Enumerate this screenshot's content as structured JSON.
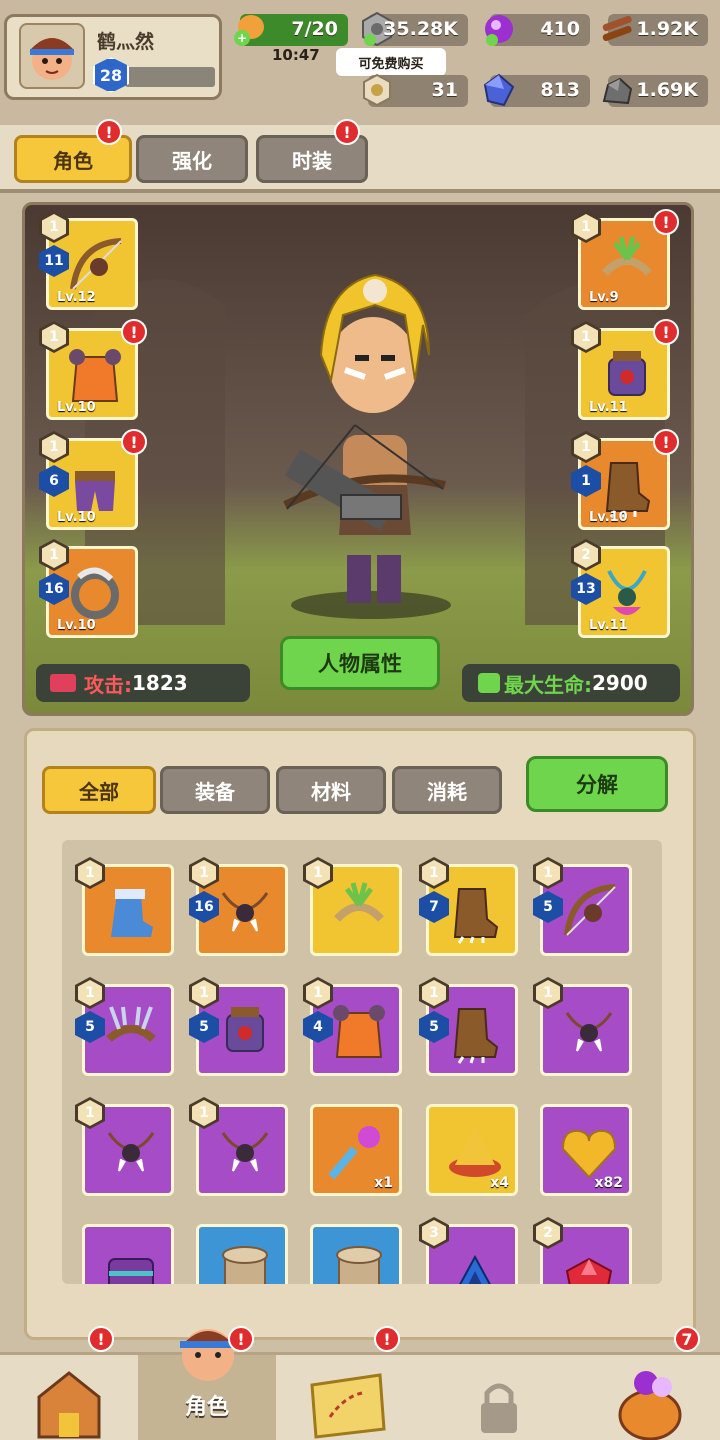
{
  "player": {
    "name": "鹤灬然",
    "level": "28"
  },
  "resources": {
    "stamina": "7/20",
    "stamina_timer": "10:47",
    "silver": "35.28K",
    "gems": "410",
    "wood": "1.92K",
    "medal": "31",
    "crystal": "813",
    "stone": "1.69K",
    "free_buy_tip": "可免费购买"
  },
  "tabs": [
    {
      "label": "角色",
      "active": true,
      "alert": "!"
    },
    {
      "label": "强化",
      "active": false,
      "alert": ""
    },
    {
      "label": "时装",
      "active": false,
      "alert": "!"
    }
  ],
  "equipment": {
    "left": [
      {
        "level": "Lv.12",
        "star": "1",
        "plus": "11",
        "color": "gold",
        "icon": "bow-icon",
        "alert": ""
      },
      {
        "level": "Lv.10",
        "star": "1",
        "plus": "",
        "color": "gold",
        "icon": "tunic-icon",
        "alert": "!"
      },
      {
        "level": "Lv.10",
        "star": "1",
        "plus": "6",
        "color": "gold",
        "icon": "pants-icon",
        "alert": "!"
      },
      {
        "level": "Lv.10",
        "star": "1",
        "plus": "16",
        "color": "orange",
        "icon": "tusk-ring-icon",
        "alert": ""
      }
    ],
    "right": [
      {
        "level": "Lv.9",
        "star": "1",
        "plus": "",
        "color": "orange",
        "icon": "leaf-headband-icon",
        "alert": "!"
      },
      {
        "level": "Lv.11",
        "star": "1",
        "plus": "",
        "color": "gold",
        "icon": "bracer-icon",
        "alert": "!"
      },
      {
        "level": "Lv.10",
        "star": "1",
        "plus": "1",
        "color": "orange",
        "icon": "claw-boots-icon",
        "alert": "!"
      },
      {
        "level": "Lv.11",
        "star": "2",
        "plus": "13",
        "color": "gold",
        "icon": "necklace-icon",
        "alert": ""
      }
    ]
  },
  "stats": {
    "attack_label": "攻击:",
    "attack_value": "1823",
    "hp_label": "最大生命:",
    "hp_value": "2900",
    "attributes_button": "人物属性"
  },
  "inventory": {
    "tabs": [
      "全部",
      "装备",
      "材料",
      "消耗"
    ],
    "decompose_button": "分解",
    "items": [
      {
        "color": "orange",
        "star": "1",
        "plus": "",
        "icon": "fur-boots-icon",
        "qty": ""
      },
      {
        "color": "orange",
        "star": "1",
        "plus": "16",
        "icon": "tooth-necklace-icon",
        "qty": ""
      },
      {
        "color": "gold",
        "star": "1",
        "plus": "",
        "icon": "leaf-headband-icon",
        "qty": ""
      },
      {
        "color": "gold",
        "star": "1",
        "plus": "7",
        "icon": "claw-boots-icon",
        "qty": ""
      },
      {
        "color": "purple",
        "star": "1",
        "plus": "5",
        "icon": "bow-icon",
        "qty": ""
      },
      {
        "color": "purple",
        "star": "1",
        "plus": "5",
        "icon": "antler-headband-icon",
        "qty": ""
      },
      {
        "color": "purple",
        "star": "1",
        "plus": "5",
        "icon": "bracer-icon",
        "qty": ""
      },
      {
        "color": "purple",
        "star": "1",
        "plus": "4",
        "icon": "tunic-icon",
        "qty": ""
      },
      {
        "color": "purple",
        "star": "1",
        "plus": "5",
        "icon": "claw-boots-icon",
        "qty": ""
      },
      {
        "color": "purple",
        "star": "1",
        "plus": "",
        "icon": "tooth-necklace-icon",
        "qty": ""
      },
      {
        "color": "purple",
        "star": "1",
        "plus": "",
        "icon": "tooth-necklace-icon",
        "qty": ""
      },
      {
        "color": "purple",
        "star": "1",
        "plus": "",
        "icon": "tooth-necklace-icon",
        "qty": ""
      },
      {
        "color": "orange",
        "star": "",
        "plus": "",
        "icon": "key-icon",
        "qty": "x1"
      },
      {
        "color": "gold",
        "star": "",
        "plus": "",
        "icon": "gold-pyramid-icon",
        "qty": "x4"
      },
      {
        "color": "purple",
        "star": "",
        "plus": "",
        "icon": "gold-heart-icon",
        "qty": "x82"
      },
      {
        "color": "purple",
        "star": "",
        "plus": "",
        "icon": "armor-plate-icon",
        "qty": ""
      },
      {
        "color": "blue",
        "star": "",
        "plus": "",
        "icon": "scroll-icon",
        "qty": ""
      },
      {
        "color": "blue",
        "star": "",
        "plus": "",
        "icon": "scroll-icon",
        "qty": ""
      },
      {
        "color": "purple",
        "star": "3",
        "plus": "",
        "icon": "blue-triangle-gem-icon",
        "qty": ""
      },
      {
        "color": "purple",
        "star": "2",
        "plus": "",
        "icon": "red-gem-icon",
        "qty": ""
      }
    ]
  },
  "nav": [
    {
      "label": "",
      "icon": "fortress-icon",
      "alert": "!"
    },
    {
      "label": "角色",
      "icon": "hero-face-icon",
      "alert": "!",
      "active": true
    },
    {
      "label": "",
      "icon": "treasure-map-icon",
      "alert": "!"
    },
    {
      "label": "",
      "icon": "lock-icon",
      "alert": ""
    },
    {
      "label": "",
      "icon": "loot-bag-icon",
      "alert": "7"
    }
  ]
}
